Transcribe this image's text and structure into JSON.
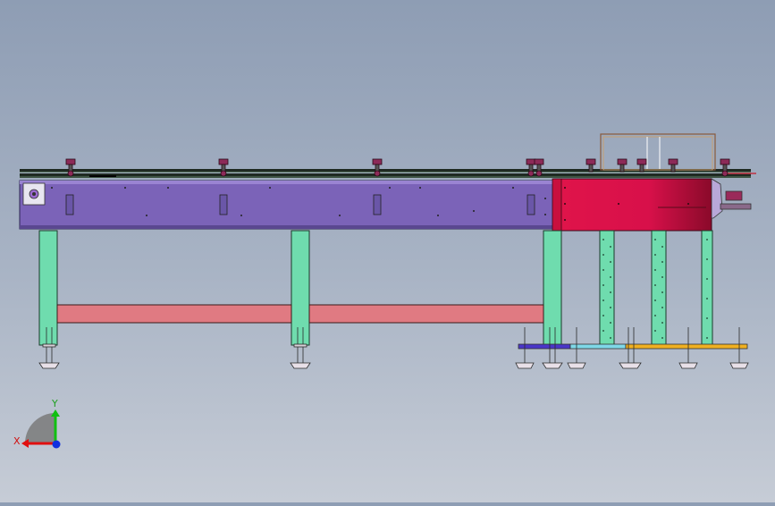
{
  "view": {
    "background_top": "#8e9db4",
    "background_bottom": "#c6ccd6"
  },
  "triad": {
    "x_label": "X",
    "y_label": "Y",
    "x_color": "#e01010",
    "y_color": "#10c010",
    "z_color": "#1030e0"
  },
  "model": {
    "conveyor_body_color": "#7b63b8",
    "transfer_section_color": "#e0144a",
    "leg_color": "#6fdcae",
    "crossbar_color": "#e07a82",
    "guide_rail_color": "#1f2a22",
    "knob_color": "#8c2a58",
    "frame_color": "#b07850",
    "base_rail_colors": [
      "#4a36c8",
      "#7fd8e8",
      "#f0b020"
    ]
  }
}
